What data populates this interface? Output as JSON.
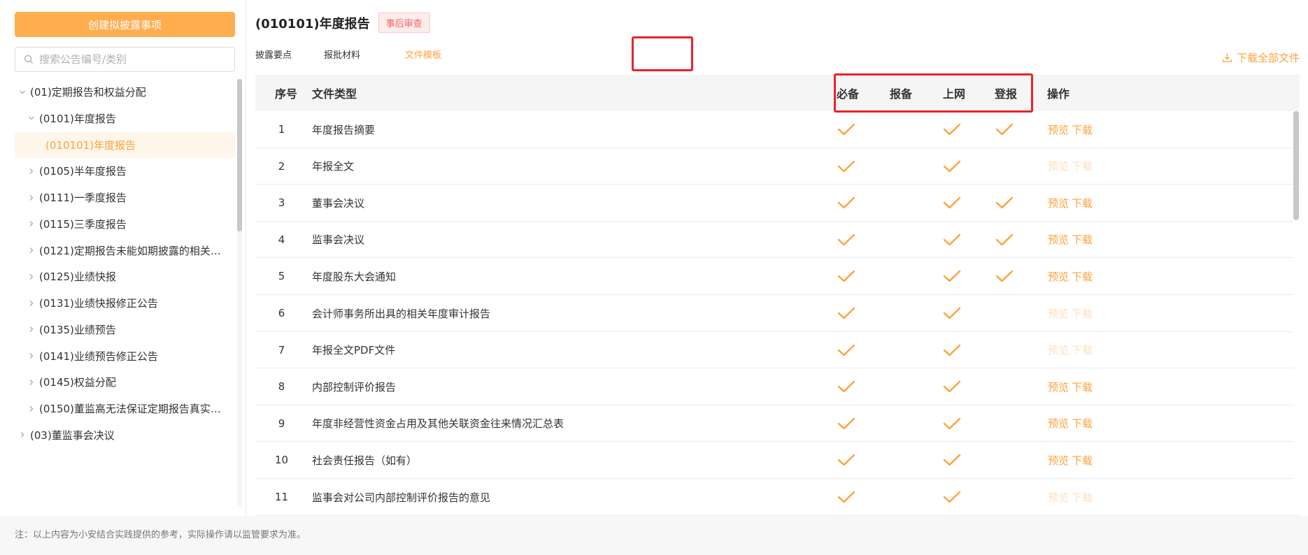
{
  "sidebar": {
    "create_label": "创建拟披露事项",
    "search_placeholder": "搜索公告编号/类别",
    "tree": [
      {
        "label": "(01)定期报告和权益分配",
        "level": 0,
        "expanded": true
      },
      {
        "label": "(0101)年度报告",
        "level": 1,
        "expanded": true
      },
      {
        "label": "(010101)年度报告",
        "level": 2,
        "selected": true
      },
      {
        "label": "(0105)半年度报告",
        "level": 1
      },
      {
        "label": "(0111)一季度报告",
        "level": 1
      },
      {
        "label": "(0115)三季度报告",
        "level": 1
      },
      {
        "label": "(0121)定期报告未能如期披露的相关…",
        "level": 1
      },
      {
        "label": "(0125)业绩快报",
        "level": 1
      },
      {
        "label": "(0131)业绩快报修正公告",
        "level": 1
      },
      {
        "label": "(0135)业绩预告",
        "level": 1
      },
      {
        "label": "(0141)业绩预告修正公告",
        "level": 1
      },
      {
        "label": "(0145)权益分配",
        "level": 1
      },
      {
        "label": "(0150)董监高无法保证定期报告真实…",
        "level": 1
      },
      {
        "label": "(03)董监事会决议",
        "level": 0
      }
    ]
  },
  "header": {
    "title": "(010101)年度报告",
    "badge": "事后审查"
  },
  "tabs": [
    {
      "label": "披露要点",
      "active": false
    },
    {
      "label": "报批材料",
      "active": false
    },
    {
      "label": "文件模板",
      "active": true
    }
  ],
  "download_all_label": "下载全部文件",
  "table": {
    "headers": {
      "index": "序号",
      "type": "文件类型",
      "required": "必备",
      "filing": "报备",
      "online": "上网",
      "publish": "登报",
      "ops": "操作"
    },
    "preview_label": "预览",
    "download_label": "下载",
    "rows": [
      {
        "index": "1",
        "type": "年度报告摘要",
        "required": true,
        "filing": false,
        "online": true,
        "publish": true,
        "ops_enabled": true
      },
      {
        "index": "2",
        "type": "年报全文",
        "required": true,
        "filing": false,
        "online": true,
        "publish": false,
        "ops_enabled": false
      },
      {
        "index": "3",
        "type": "董事会决议",
        "required": true,
        "filing": false,
        "online": true,
        "publish": true,
        "ops_enabled": true
      },
      {
        "index": "4",
        "type": "监事会决议",
        "required": true,
        "filing": false,
        "online": true,
        "publish": true,
        "ops_enabled": true
      },
      {
        "index": "5",
        "type": "年度股东大会通知",
        "required": true,
        "filing": false,
        "online": true,
        "publish": true,
        "ops_enabled": true
      },
      {
        "index": "6",
        "type": "会计师事务所出具的相关年度审计报告",
        "required": true,
        "filing": false,
        "online": true,
        "publish": false,
        "ops_enabled": false
      },
      {
        "index": "7",
        "type": "年报全文PDF文件",
        "required": true,
        "filing": false,
        "online": true,
        "publish": false,
        "ops_enabled": false
      },
      {
        "index": "8",
        "type": "内部控制评价报告",
        "required": true,
        "filing": false,
        "online": true,
        "publish": false,
        "ops_enabled": true
      },
      {
        "index": "9",
        "type": "年度非经营性资金占用及其他关联资金往来情况汇总表",
        "required": true,
        "filing": false,
        "online": true,
        "publish": false,
        "ops_enabled": true
      },
      {
        "index": "10",
        "type": "社会责任报告（如有）",
        "required": true,
        "filing": false,
        "online": true,
        "publish": false,
        "ops_enabled": true
      },
      {
        "index": "11",
        "type": "监事会对公司内部控制评价报告的意见",
        "required": true,
        "filing": false,
        "online": true,
        "publish": false,
        "ops_enabled": false
      }
    ]
  },
  "footer_note": "注：以上内容为小安结合实践提供的参考，实际操作请以监管要求为准。",
  "colors": {
    "accent": "#ffa23a",
    "button": "#ffad4d",
    "highlight": "#e8232a",
    "badge_text": "#f26363"
  }
}
